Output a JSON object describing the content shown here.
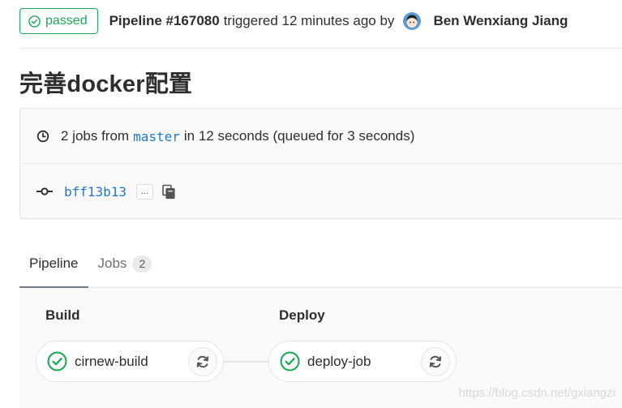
{
  "header": {
    "status_label": "passed",
    "pipeline_id": "Pipeline #167080",
    "triggered_text": "triggered 12 minutes ago by",
    "author": "Ben Wenxiang Jiang"
  },
  "title": "完善docker配置",
  "info": {
    "jobs_count": "2 jobs from",
    "branch": "master",
    "duration_text": "in 12 seconds (queued for 3 seconds)",
    "commit_sha": "bff13b13",
    "ellipsis": "..."
  },
  "tabs": [
    {
      "label": "Pipeline"
    },
    {
      "label": "Jobs",
      "count": "2"
    }
  ],
  "stages": [
    {
      "title": "Build",
      "job": "cirnew-build"
    },
    {
      "title": "Deploy",
      "job": "deploy-job"
    }
  ],
  "colors": {
    "success": "#1aaa55",
    "link": "#1f78d1"
  },
  "watermark": "https://blog.csdn.net/gxiangzi"
}
